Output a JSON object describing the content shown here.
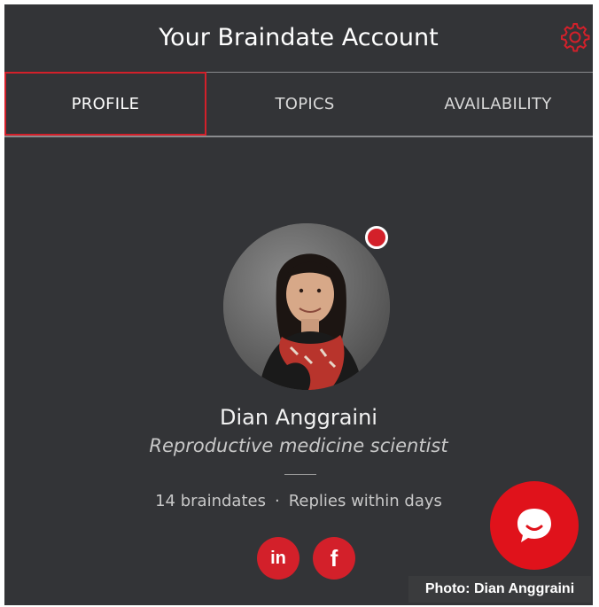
{
  "header": {
    "title": "Your Braindate Account",
    "settings_icon": "gear-icon"
  },
  "tabs": [
    {
      "label": "PROFILE",
      "active": true
    },
    {
      "label": "TOPICS",
      "active": false
    },
    {
      "label": "AVAILABILITY",
      "active": false
    }
  ],
  "profile": {
    "name": "Dian Anggraini",
    "subtitle": "Reproductive medicine scientist",
    "braindates": "14 braindates",
    "separator": "·",
    "replies": "Replies within days",
    "online": true
  },
  "social": {
    "linkedin_label": "in",
    "facebook_label": "f"
  },
  "chat_icon": "chat-bubble-icon",
  "caption": "Photo: Dian Anggraini",
  "colors": {
    "background": "#333437",
    "accent": "#d3202a",
    "text": "#ffffff"
  }
}
